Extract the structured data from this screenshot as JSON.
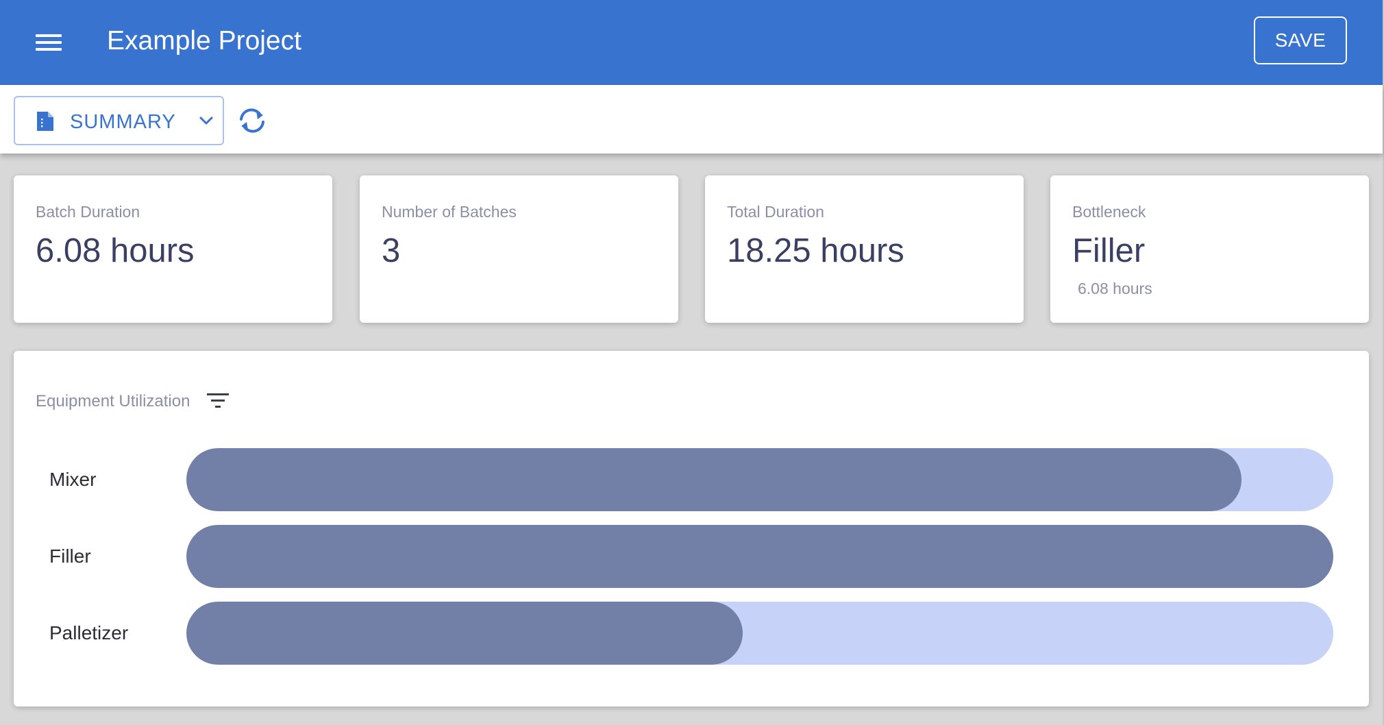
{
  "appbar": {
    "title": "Example Project",
    "save_label": "SAVE"
  },
  "toolbar": {
    "view_label": "SUMMARY"
  },
  "stats": [
    {
      "label": "Batch Duration",
      "value": "6.08 hours",
      "sub": ""
    },
    {
      "label": "Number of Batches",
      "value": "3",
      "sub": ""
    },
    {
      "label": "Total Duration",
      "value": "18.25 hours",
      "sub": ""
    },
    {
      "label": "Bottleneck",
      "value": "Filler",
      "sub": "6.08 hours"
    }
  ],
  "utilization": {
    "title": "Equipment Utilization",
    "items": [
      {
        "name": "Mixer",
        "fraction": 0.92
      },
      {
        "name": "Filler",
        "fraction": 1.0
      },
      {
        "name": "Palletizer",
        "fraction": 0.485
      }
    ]
  },
  "colors": {
    "primary": "#3874cf",
    "bar_fill": "#727fa7",
    "bar_track": "#c6d2f8"
  }
}
